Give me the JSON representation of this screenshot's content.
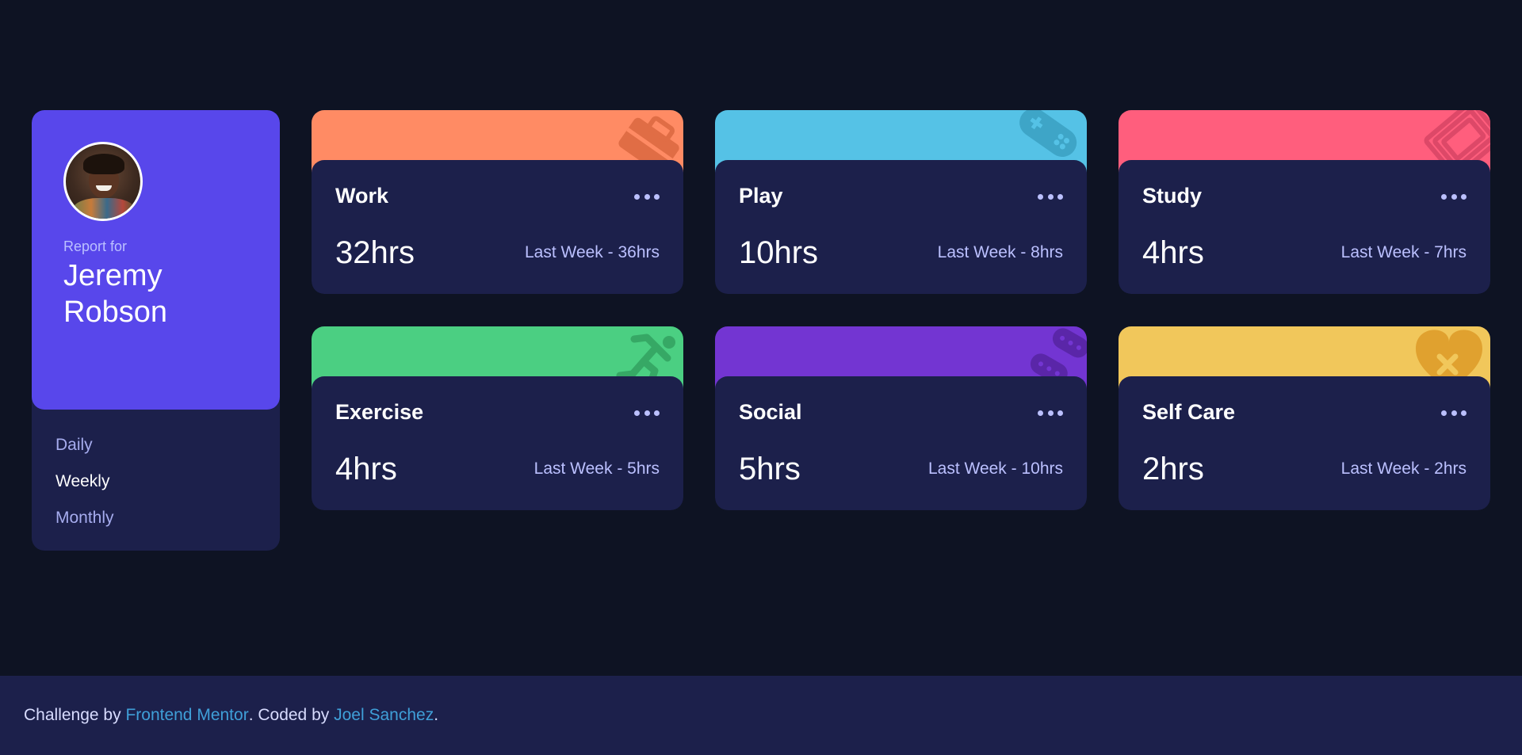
{
  "profile": {
    "report_for": "Report for",
    "name": "Jeremy Robson",
    "periods": [
      {
        "label": "Daily",
        "active": false
      },
      {
        "label": "Weekly",
        "active": true
      },
      {
        "label": "Monthly",
        "active": false
      }
    ]
  },
  "cards": [
    {
      "title": "Work",
      "hours": "32hrs",
      "last": "Last Week - 36hrs",
      "color": "#ff8b64",
      "icon": "briefcase-icon"
    },
    {
      "title": "Play",
      "hours": "10hrs",
      "last": "Last Week - 8hrs",
      "color": "#55c2e6",
      "icon": "gamepad-icon"
    },
    {
      "title": "Study",
      "hours": "4hrs",
      "last": "Last Week - 7hrs",
      "color": "#ff5e7d",
      "icon": "book-icon"
    },
    {
      "title": "Exercise",
      "hours": "4hrs",
      "last": "Last Week - 5hrs",
      "color": "#4bcf82",
      "icon": "running-person-icon"
    },
    {
      "title": "Social",
      "hours": "5hrs",
      "last": "Last Week - 10hrs",
      "color": "#7335d2",
      "icon": "chat-bubbles-icon"
    },
    {
      "title": "Self Care",
      "hours": "2hrs",
      "last": "Last Week - 2hrs",
      "color": "#f1c75b",
      "icon": "heart-icon"
    }
  ],
  "footer": {
    "prefix": "Challenge by ",
    "link1": "Frontend Mentor",
    "middle": ". Coded by ",
    "link2": "Joel Sanchez",
    "suffix": "."
  }
}
